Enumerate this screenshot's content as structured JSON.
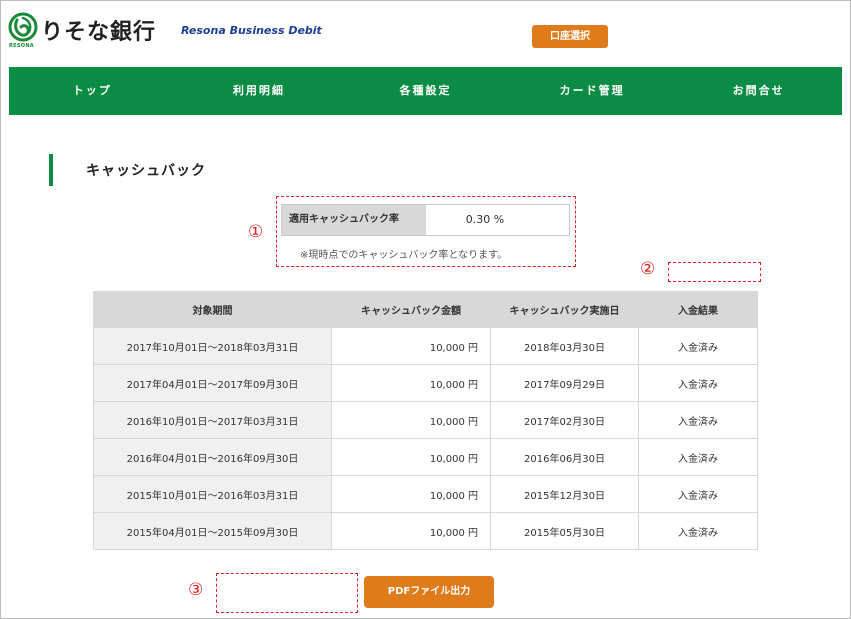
{
  "header": {
    "bank_name": "りそな銀行",
    "logo_word": "RESONA",
    "service_name": "Resona Business Debit",
    "account_select_button": "口座選択"
  },
  "nav": [
    "トップ",
    "利用明細",
    "各種設定",
    "カード管理",
    "お問合せ"
  ],
  "page_title": "キャッシュバック",
  "rate": {
    "label": "適用キャッシュバック率",
    "value": "0.30 %",
    "note": "※現時点でのキャッシュバック率となります。"
  },
  "markers": [
    "①",
    "②",
    "③"
  ],
  "table": {
    "headers": [
      "対象期間",
      "キャッシュバック金額",
      "キャッシュバック実施日",
      "入金結果"
    ],
    "rows": [
      [
        "2017年10月01日～2018年03月31日",
        "10,000 円",
        "2018年03月30日",
        "入金済み"
      ],
      [
        "2017年04月01日～2017年09月30日",
        "10,000 円",
        "2017年09月29日",
        "入金済み"
      ],
      [
        "2016年10月01日～2017年03月31日",
        "10,000 円",
        "2017年02月30日",
        "入金済み"
      ],
      [
        "2016年04月01日～2016年09月30日",
        "10,000 円",
        "2016年06月30日",
        "入金済み"
      ],
      [
        "2015年10月01日～2016年03月31日",
        "10,000 円",
        "2015年12月30日",
        "入金済み"
      ],
      [
        "2015年04月01日～2015年09月30日",
        "10,000 円",
        "2015年05月30日",
        "入金済み"
      ]
    ]
  },
  "pdf_button": "PDFファイル出力",
  "colors": {
    "brand_green": "#0b8c45",
    "accent_orange": "#e07b1c",
    "annotation_red": "#e02020"
  }
}
